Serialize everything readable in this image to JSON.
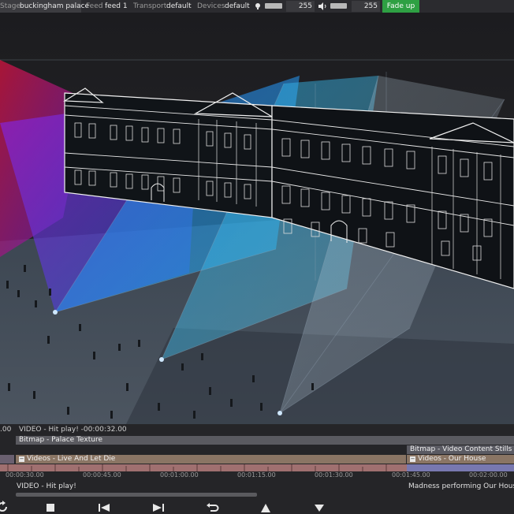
{
  "topbar": {
    "stage_label": "Stage",
    "stage_value": "buckingham palace",
    "feed_label": "Feed",
    "feed_value": "feed 1",
    "transport_label": "Transport",
    "transport_value": "default",
    "devices_label": "Devices",
    "devices_value": "default",
    "brightness_icon": "bulb-icon",
    "brightness_value": "255",
    "volume_icon": "speaker-icon",
    "volume_value": "255",
    "fade_button": "Fade up"
  },
  "timeline": {
    "status_left_prefix": ".00",
    "status_line": "VIDEO - Hit play! -00:00:32.00",
    "tracks": {
      "bitmap_palace": "Bitmap - Palace Texture",
      "bitmap_stills": "Bitmap - Video Content Stills",
      "videos_live": "Videos - Live And Let Die",
      "videos_house": "Videos - Our House"
    },
    "ruler": [
      "00:00:30.00",
      "00:00:45.00",
      "00:01:00.00",
      "00:01:15.00",
      "00:01:30.00",
      "00:01:45.00",
      "00:02:00.00"
    ],
    "cue_left": "VIDEO - Hit play!",
    "cue_right": "Madness performing Our House"
  },
  "controls": {
    "refresh": "refresh-icon",
    "stop": "stop-icon",
    "prev": "skip-back-icon",
    "next": "skip-forward-icon",
    "undo": "undo-icon",
    "up": "arrow-up-icon",
    "down": "arrow-down-icon"
  },
  "colors": {
    "accent_green": "#2ea043",
    "track_blue": "#4a4a6a",
    "track_brown": "#7a6a5a"
  }
}
